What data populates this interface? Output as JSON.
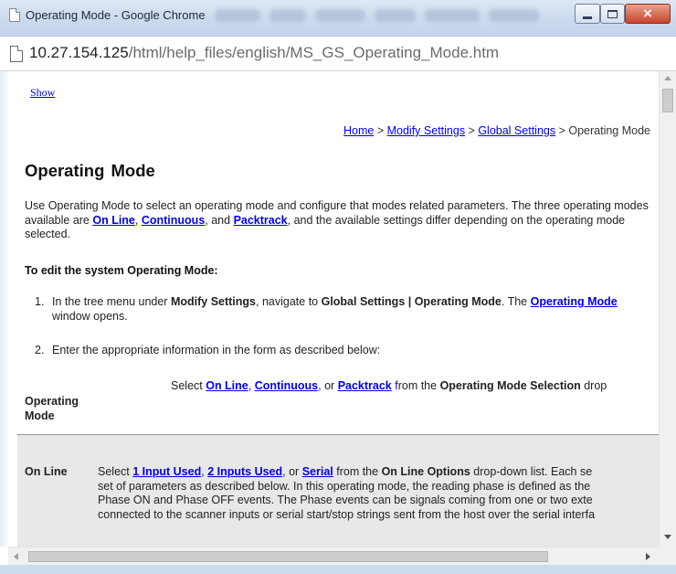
{
  "window": {
    "title": "Operating Mode - Google Chrome",
    "controls": {
      "minimize_icon": "minimize-icon",
      "maximize_icon": "maximize-icon",
      "close_icon": "close-icon",
      "close_glyph": "×"
    }
  },
  "address": {
    "url_host": "10.27.154.125",
    "url_path": "/html/help_files/english/MS_GS_Operating_Mode.htm",
    "page_icon": "page-icon"
  },
  "page": {
    "show_link": "Show",
    "breadcrumb": {
      "home": "Home",
      "sep": " > ",
      "modify": "Modify Settings",
      "global": "Global Settings",
      "current": "Operating Mode"
    },
    "heading": "Operating  Mode",
    "intro": {
      "t1": "Use Operating Mode to select an operating mode and configure that modes related parameters. The three operating modes available are ",
      "link1": "On Line",
      "t2": ", ",
      "link2": "Continuous",
      "t3": ", and ",
      "link3": "Packtrack",
      "t4": ", and the available settings differ depending on the operating mode selected."
    },
    "edit_heading": "To edit the system Operating Mode:",
    "steps": [
      {
        "num": "1.",
        "t1": "In the tree menu under ",
        "b1": "Modify Settings",
        "t2": ", navigate to ",
        "b2": "Global Settings | Operating Mode",
        "t3": ". The ",
        "link": "Operating Mode",
        "t4": " window opens."
      },
      {
        "num": "2.",
        "text": "Enter the appropriate information in the form as described below:"
      }
    ],
    "table": {
      "row1": {
        "label_line1": "Operating",
        "label_line2": "Mode",
        "t1": "Select ",
        "link1": "On Line",
        "t2": ", ",
        "link2": "Continuous",
        "t3": ", or ",
        "link3": "Packtrack",
        "t4": " from the ",
        "b1": "Operating Mode Selection",
        "t5": " drop"
      },
      "row2": {
        "label": "On Line",
        "t1": "Select ",
        "link1": "1 Input Used",
        "t2": ", ",
        "link2": "2 Inputs Used",
        "t3": ", or ",
        "link3": "Serial",
        "t4": " from the ",
        "b1": "On Line Options",
        "t5": " drop-down list. Each se",
        "line2": "set of parameters as described below. In this operating mode, the reading phase is defined as the",
        "line3": "Phase ON and Phase OFF events. The Phase events can be signals coming from one or two exte",
        "line4": "connected to the scanner inputs or serial start/stop strings sent from the host over the serial interfa"
      }
    }
  },
  "colors": {
    "link": "#0000ee",
    "row_bg": "#e8e8e8",
    "titlebar": "#cddbee",
    "close": "#c8452c"
  }
}
